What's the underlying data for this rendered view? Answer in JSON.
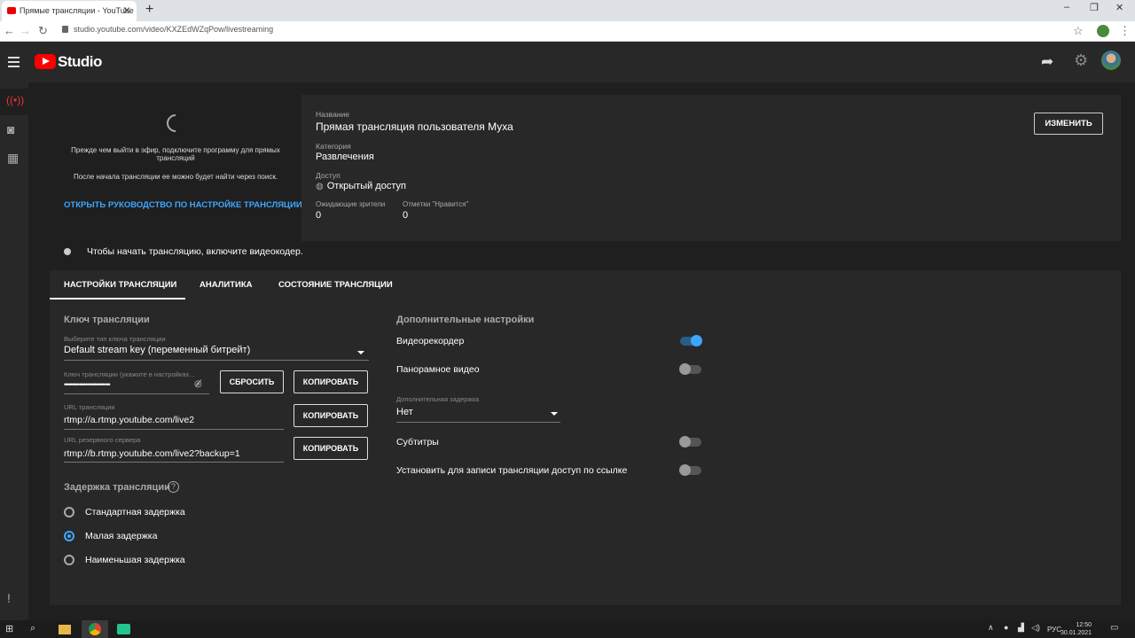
{
  "browser": {
    "tab_title": "Прямые трансляции - YouTube",
    "tab_close": "✕",
    "new_tab": "+",
    "url": "studio.youtube.com/video/KXZEdWZqPow/livestreaming",
    "window_controls": [
      "–",
      "❐",
      "✕"
    ]
  },
  "header": {
    "app_name": "Studio",
    "icons": [
      "menu-icon",
      "share-icon",
      "settings-icon",
      "avatar"
    ]
  },
  "preview": {
    "message1": "Прежде чем выйти в эфир, подключите программу для прямых трансляций",
    "message2": "После начала трансляции ее можно будет найти через поиск.",
    "guide_link": "ОТКРЫТЬ РУКОВОДСТВО ПО НАСТРОЙКЕ ТРАНСЛЯЦИИ"
  },
  "info": {
    "title_label": "Название",
    "title_value": "Прямая трансляция пользователя Муха",
    "category_label": "Категория",
    "category_value": "Развлечения",
    "access_label": "Доступ",
    "access_value": "Открытый доступ",
    "viewers_label": "Ожидающие зрители",
    "viewers_value": "0",
    "likes_label": "Отметки \"Нравится\"",
    "likes_value": "0",
    "edit_button": "ИЗМЕНИТЬ"
  },
  "status": {
    "text": "Чтобы начать трансляцию, включите видеокодер."
  },
  "tabs": [
    "НАСТРОЙКИ ТРАНСЛЯЦИИ",
    "АНАЛИТИКА",
    "СОСТОЯНИЕ ТРАНСЛЯЦИИ"
  ],
  "stream_key": {
    "heading": "Ключ трансляции",
    "type_label": "Выберите тип ключа трансляции",
    "type_value": "Default stream key (переменный битрейт)",
    "key_label": "Ключ трансляции (укажите в настройках...",
    "key_value": "••••••••••••••••••••••••",
    "reset_button": "СБРОСИТЬ",
    "copy_button": "КОПИРОВАТЬ",
    "url_label": "URL трансляции",
    "url_value": "rtmp://a.rtmp.youtube.com/live2",
    "backup_label": "URL резервного сервера",
    "backup_value": "rtmp://b.rtmp.youtube.com/live2?backup=1"
  },
  "latency": {
    "heading": "Задержка трансляции",
    "options": [
      "Стандартная задержка",
      "Малая задержка",
      "Наименьшая задержка"
    ],
    "selected": "Малая задержка"
  },
  "additional": {
    "heading": "Дополнительные настройки",
    "dvr_label": "Видеорекордер",
    "dvr_on": true,
    "panorama_label": "Панорамное видео",
    "panorama_on": false,
    "delay_label": "Дополнительная задержка",
    "delay_value": "Нет",
    "subtitles_label": "Субтитры",
    "subtitles_on": false,
    "unlisted_label": "Установить для записи трансляции доступ по ссылке",
    "unlisted_on": false
  },
  "taskbar": {
    "lang": "РУС",
    "time": "12:50",
    "date": "30.01.2021"
  },
  "colors": {
    "accent": "#3ea6ff",
    "brand": "#ff0000",
    "background": "#1f1f1f",
    "panel": "#282828"
  }
}
